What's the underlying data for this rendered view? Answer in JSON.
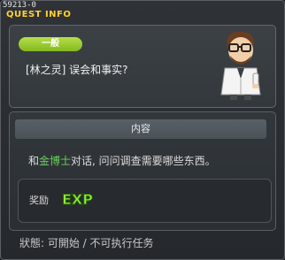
{
  "quest": {
    "id": "59213-0",
    "window_title": "QUEST INFO",
    "category": "一般",
    "name": "[林之灵] 误会和事实?"
  },
  "content": {
    "header": "内容",
    "prefix": "和",
    "npc": "金博士",
    "suffix": "对话, 问问调查需要哪些东西。"
  },
  "reward": {
    "label": "奖励",
    "exp_text": "EXP",
    "exp_color": "#8df03a"
  },
  "status": {
    "text": "狀態: 可開始 / 不可执行任务"
  },
  "colors": {
    "title": "#ffd22e",
    "badge": "#9fd036",
    "npc": "#67d15a"
  },
  "icons": {
    "portrait": "doctor-npc-portrait"
  }
}
